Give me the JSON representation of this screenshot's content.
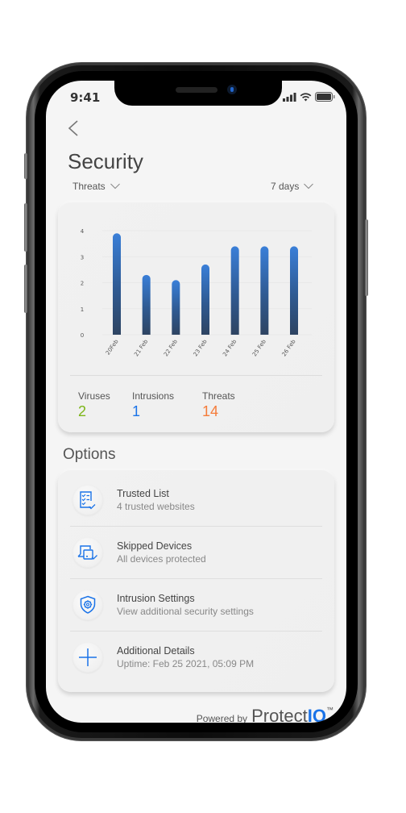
{
  "status_bar": {
    "time": "9:41"
  },
  "header": {
    "title": "Security",
    "back_icon": "chevron-left-icon"
  },
  "filters": {
    "metric": "Threats",
    "range": "7 days"
  },
  "colors": {
    "accent": "#1a73e8",
    "viruses": "#7cb518",
    "intrusions": "#1a73e8",
    "threats": "#f57c3a",
    "bar_top": "#3a7fd8",
    "bar_bottom": "#2e4462"
  },
  "chart_data": {
    "type": "bar",
    "title": "",
    "xlabel": "",
    "ylabel": "",
    "categories": [
      "20Feb",
      "21 Feb",
      "22 Feb",
      "23 Feb",
      "24 Feb",
      "25 Feb",
      "26 Feb"
    ],
    "values": [
      3.9,
      2.3,
      2.1,
      2.7,
      3.4,
      3.4,
      3.4
    ],
    "yticks": [
      "0",
      "1",
      "2",
      "3",
      "4"
    ],
    "ylim": [
      0,
      4
    ],
    "grid": true,
    "legend": "none"
  },
  "stats": [
    {
      "label": "Viruses",
      "value": "2"
    },
    {
      "label": "Intrusions",
      "value": "1"
    },
    {
      "label": "Threats",
      "value": "14"
    }
  ],
  "options": {
    "label": "Options",
    "items": [
      {
        "title": "Trusted List",
        "subtitle": "4 trusted websites",
        "icon": "checklist-icon"
      },
      {
        "title": "Skipped Devices",
        "subtitle": "All devices protected",
        "icon": "devices-check-icon"
      },
      {
        "title": "Intrusion Settings",
        "subtitle": "View additional security settings",
        "icon": "shield-gear-icon"
      },
      {
        "title": "Additional Details",
        "subtitle": "Uptime: Feb 25 2021, 05:09 PM",
        "icon": "plus-icon"
      }
    ]
  },
  "footer": {
    "powered_by": "Powered by",
    "brand_main": "Protect",
    "brand_accent": "IQ",
    "trademark": "™"
  }
}
